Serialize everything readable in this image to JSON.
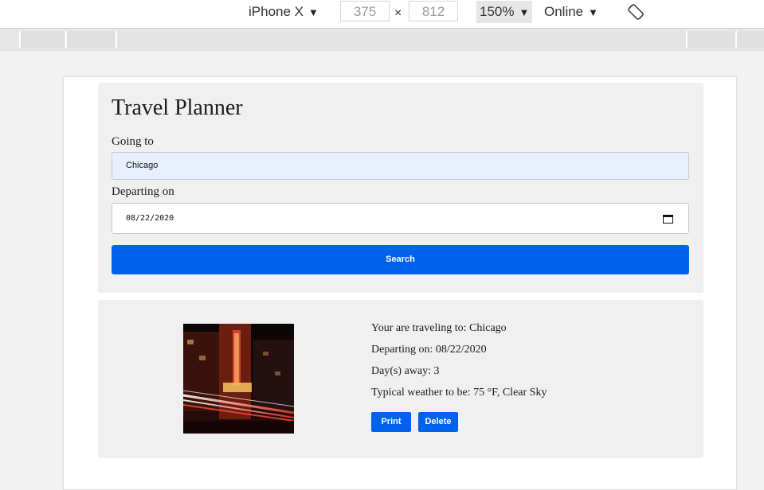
{
  "toolbar": {
    "device": "iPhone X",
    "width": "375",
    "times": "×",
    "height": "812",
    "zoom": "150%",
    "network": "Online",
    "dropdown_arrow": "▼",
    "rotate_icon": "rotate-icon"
  },
  "app": {
    "title": "Travel Planner",
    "going_label": "Going to",
    "destination_value": "Chicago",
    "departing_label": "Departing on",
    "date_value": "08/22/2020",
    "search_label": "Search"
  },
  "result": {
    "destination_text": "Your are traveling to: Chicago",
    "departing_text": "Departing on: 08/22/2020",
    "days_text": "Day(s) away: 3",
    "weather_text": "Typical weather to be: 75 °F, Clear Sky",
    "print_label": "Print",
    "delete_label": "Delete"
  },
  "colors": {
    "primary": "#0061eb",
    "card": "#f0f0f0",
    "autofill": "#e8f0fe"
  }
}
